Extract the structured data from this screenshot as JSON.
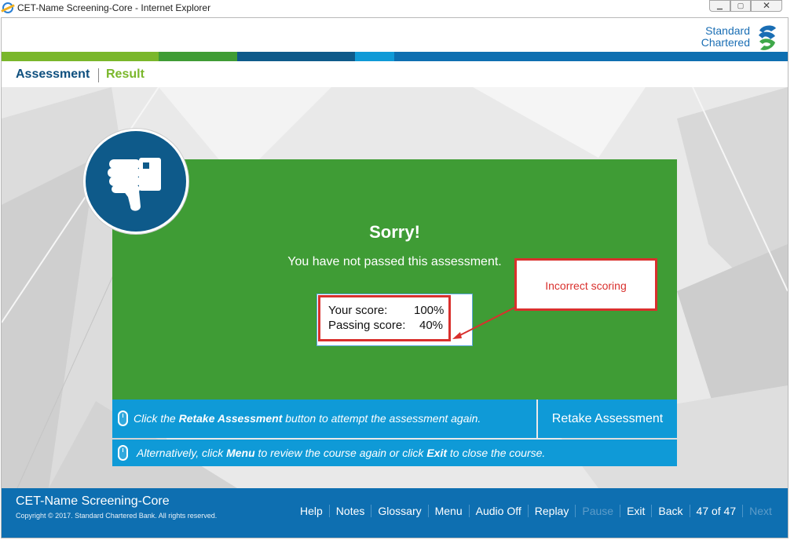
{
  "window": {
    "title": "CET-Name Screening-Core - Internet Explorer"
  },
  "brand": {
    "line1": "Standard",
    "line2": "Chartered"
  },
  "colors": {
    "green_light": "#7ab72b",
    "green_dark": "#3f9c35",
    "navy": "#0e5a8a",
    "blue": "#0f9ad7",
    "footer_blue": "#0e6fb1",
    "red": "#d9302d"
  },
  "nav": {
    "tabs": [
      {
        "label": "Assessment",
        "active": true
      },
      {
        "label": "Result",
        "active": false
      }
    ]
  },
  "result": {
    "heading": "Sorry!",
    "message": "You have not passed this assessment.",
    "your_score_label": "Your score:",
    "your_score_value": "100%",
    "passing_score_label": "Passing score:",
    "passing_score_value": "40%",
    "icon": "thumbs-down-icon"
  },
  "annotation": {
    "text": "Incorrect scoring"
  },
  "instructions": {
    "retake_pre": "Click the ",
    "retake_bold": "Retake Assessment",
    "retake_post": " button to attempt the assessment again.",
    "alt_pre": "Alternatively, click ",
    "alt_bold1": "Menu",
    "alt_mid": " to review the course again or click ",
    "alt_bold2": "Exit",
    "alt_post": " to close the course."
  },
  "retake_button": {
    "label": "Retake Assessment"
  },
  "footer": {
    "course_title": "CET-Name Screening-Core",
    "copyright": "Copyright © 2017. Standard Chartered Bank. All rights reserved.",
    "nav": {
      "help": "Help",
      "notes": "Notes",
      "glossary": "Glossary",
      "menu": "Menu",
      "audio": "Audio Off",
      "replay": "Replay",
      "pause": "Pause",
      "exit": "Exit",
      "back": "Back",
      "page": "47 of 47",
      "next": "Next"
    }
  }
}
